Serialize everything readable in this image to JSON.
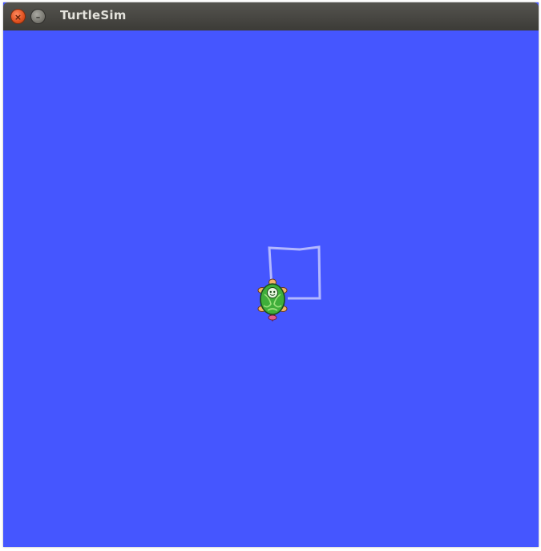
{
  "window": {
    "title": "TurtleSim",
    "close_glyph": "×",
    "minimize_glyph": "–"
  },
  "canvas": {
    "background": "#4556ff",
    "pen_color": "#b3b8ff",
    "turtle_icon": "turtle-icon"
  },
  "colors": {
    "titlebar": "#3c3b37",
    "close_button": "#e0501f",
    "title_text": "#e3e2dc"
  }
}
